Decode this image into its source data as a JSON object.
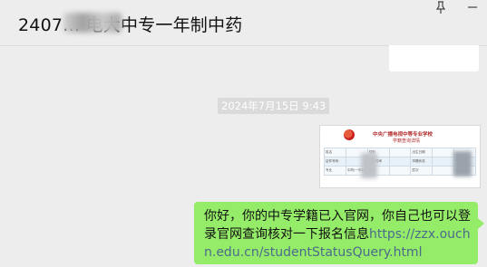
{
  "chat": {
    "title": "2407… 电大中专一年制中药"
  },
  "icons": {
    "pin": "pin-icon",
    "minimize": "minimize-icon"
  },
  "timestamp": "2024年7月15日 9:43",
  "card": {
    "school_name": "中央广播电视中等专业学校",
    "subtitle": "学籍查询详情",
    "rows": [
      [
        "姓名",
        "",
        "性别",
        "",
        "出生日期",
        "",
        ""
      ],
      [
        "证件号码",
        "",
        "入学时间",
        "",
        "学籍状态",
        "",
        ""
      ],
      [
        "专业",
        "中药(一年制)",
        "学制",
        "",
        "层次",
        "",
        "一年制"
      ]
    ]
  },
  "message": {
    "text": "你好，你的中专学籍已入官网，你自己也可以登录官网查询核对一下报名信息",
    "link": "https://zzx.ouchn.edu.cn/studentStatusQuery.html"
  },
  "colors": {
    "background": "#ededed",
    "bubble": "#95ec69",
    "timestamp_bg": "#dadada",
    "link": "#4d6a8c"
  }
}
